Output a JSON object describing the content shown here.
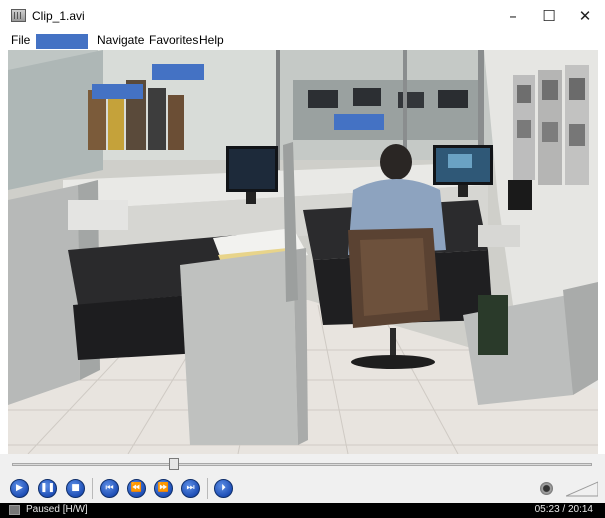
{
  "window": {
    "title": "Clip_1.avi",
    "min_glyph": "–",
    "max_glyph": "☐",
    "close_glyph": "✕"
  },
  "menu": {
    "file": "File",
    "navigate": "Navigate",
    "favorites": "Favorites",
    "help": "Help"
  },
  "player": {
    "seek_position": 0.28,
    "play_glyph": "▶",
    "pause_glyph": "❚❚",
    "stop_glyph": "■",
    "prev_glyph": "⏮",
    "rewind_glyph": "⏪",
    "forward_glyph": "⏩",
    "next_glyph": "⏭",
    "step_glyph": "⏵"
  },
  "status": {
    "state": "Paused [H/W]",
    "time": "05:23 / 20:14"
  },
  "colors": {
    "redaction": "#4472c4",
    "control_button": "#1f4fb6"
  }
}
